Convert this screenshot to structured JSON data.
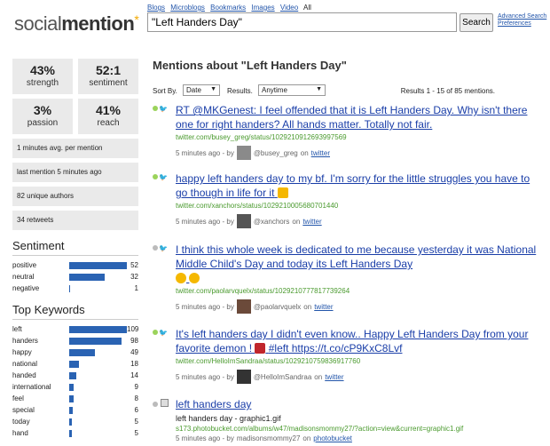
{
  "header": {
    "logo_a": "social",
    "logo_b": "mention",
    "nav": [
      "Blogs",
      "Microblogs",
      "Bookmarks",
      "Images",
      "Video",
      "All"
    ],
    "search_value": "\"Left Handers Day\"",
    "search_button": "Search",
    "advanced_1": "Advanced Search",
    "advanced_2": "Preferences"
  },
  "stats": {
    "strength_value": "43%",
    "strength_label": "strength",
    "sentiment_value": "52:1",
    "sentiment_label": "sentiment",
    "passion_value": "3%",
    "passion_label": "passion",
    "reach_value": "41%",
    "reach_label": "reach"
  },
  "info": {
    "avg": "1 minutes avg. per mention",
    "last": "last mention 5 minutes ago",
    "authors": "82 unique authors",
    "retweets": "34 retweets"
  },
  "sentiment": {
    "title": "Sentiment",
    "rows": [
      {
        "name": "positive",
        "count": "52",
        "frac": 1.0
      },
      {
        "name": "neutral",
        "count": "32",
        "frac": 0.62
      },
      {
        "name": "negative",
        "count": "1",
        "frac": 0.02
      }
    ]
  },
  "keywords": {
    "title": "Top Keywords",
    "rows": [
      {
        "name": "left",
        "count": "109",
        "frac": 1.0
      },
      {
        "name": "handers",
        "count": "98",
        "frac": 0.9
      },
      {
        "name": "happy",
        "count": "49",
        "frac": 0.45
      },
      {
        "name": "national",
        "count": "18",
        "frac": 0.17
      },
      {
        "name": "handed",
        "count": "14",
        "frac": 0.13
      },
      {
        "name": "international",
        "count": "9",
        "frac": 0.08
      },
      {
        "name": "feel",
        "count": "8",
        "frac": 0.07
      },
      {
        "name": "special",
        "count": "6",
        "frac": 0.06
      },
      {
        "name": "today",
        "count": "5",
        "frac": 0.05
      },
      {
        "name": "hand",
        "count": "5",
        "frac": 0.05
      }
    ]
  },
  "main": {
    "title": "Mentions about \"Left Handers Day\"",
    "sort_label": "Sort By.",
    "sort_value": "Date",
    "results_label": "Results.",
    "results_value": "Anytime",
    "results_text": "Results 1 - 15 of 85 mentions.",
    "mentions": [
      {
        "text": "RT @MKGenest: I feel offended that it is Left Handers Day. Why isn't there one for right handers? All hands matter. Totally not fair.",
        "url": "twitter.com/busey_greg/status/1029210912693997569",
        "ago": "5 minutes ago - by",
        "author": "@busey_greg",
        "on": "on",
        "source": "twitter"
      },
      {
        "text": "happy left handers day to my bf. I'm sorry for the little struggles you have to go though in life for it",
        "url": "twitter.com/xanchors/status/1029210005680701440",
        "ago": "5 minutes ago - by",
        "author": "@xanchors",
        "on": "on",
        "source": "twitter"
      },
      {
        "text": "I think this whole week is dedicated to me because yesterday it was National Middle Child's Day and today its Left Handers Day",
        "url": "twitter.com/paolarvquelx/status/1029210777817739264",
        "ago": "5 minutes ago - by",
        "author": "@paolarvquelx",
        "on": "on",
        "source": "twitter"
      },
      {
        "text": "It's left handers day I didn't even know.. Happy Left Handers Day from your favorite demon !",
        "text2": "#left https://t.co/cP9KxC8Lvf",
        "url": "twitter.com/HelloImSandraa/status/1029210759836917760",
        "ago": "5 minutes ago - by",
        "author": "@HelloImSandraa",
        "on": "on",
        "source": "twitter"
      },
      {
        "text": "left handers day",
        "plain": "left handers day - graphic1.gif",
        "url": "s173.photobucket.com/albums/w47/madisonsmommy27/?action=view&current=graphic1.gif",
        "ago": "5 minutes ago - by",
        "author": "madisonsmommy27",
        "on": "on",
        "source": "photobucket"
      }
    ]
  },
  "colors": {
    "bar": "#2a63b3",
    "link": "#1a3ea8",
    "url_green": "#4a9a2e"
  }
}
